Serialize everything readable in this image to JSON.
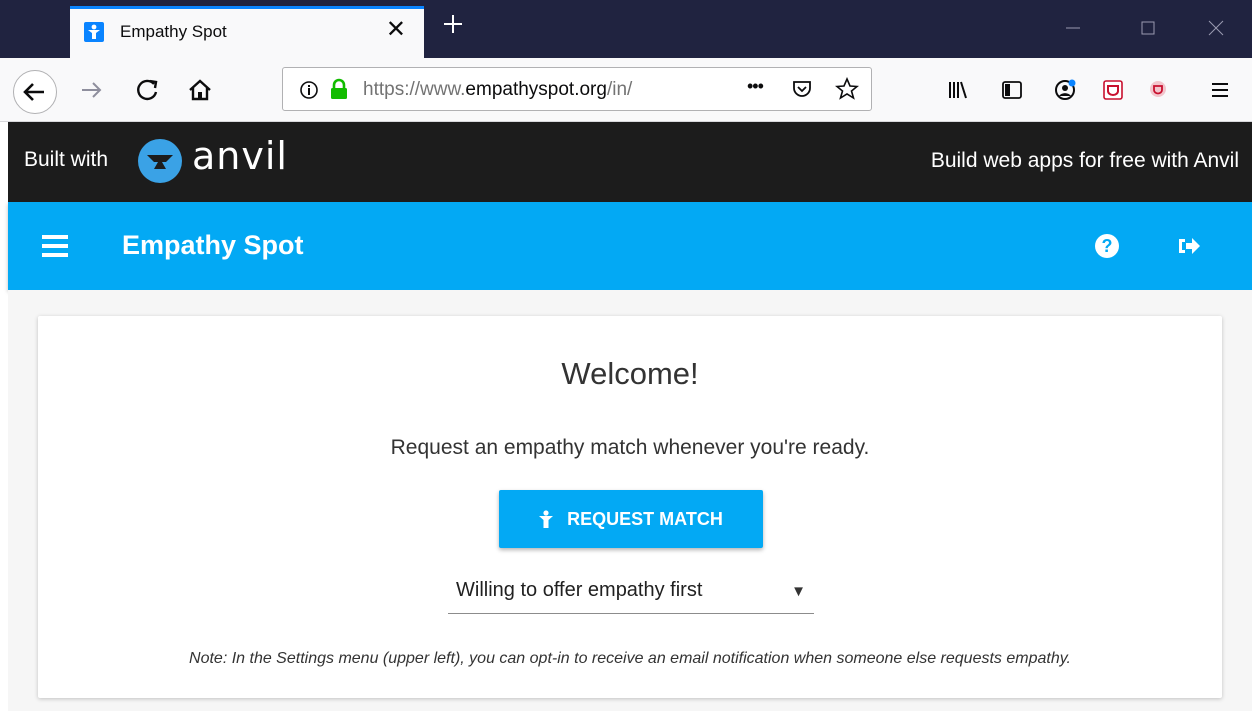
{
  "browser": {
    "tab": {
      "title": "Empathy Spot",
      "close_glyph": "✕"
    },
    "new_tab_glyph": "+",
    "url": {
      "prefix": "https://www.",
      "domain": "empathyspot.org",
      "path": "/in/"
    },
    "more_glyph": "•••"
  },
  "anvil_banner": {
    "built_with": "Built with",
    "brand": "anvil",
    "cta": "Build web apps for free with Anvil"
  },
  "header": {
    "title": "Empathy Spot",
    "help_glyph": "?"
  },
  "main": {
    "welcome": "Welcome!",
    "subtitle": "Request an empathy match whenever you're ready.",
    "request_button_label": "REQUEST MATCH",
    "dropdown": {
      "selected": "Willing to offer empathy first",
      "arrow": "▼"
    },
    "note": "Note: In the Settings menu (upper left), you can opt-in to receive an email notification when someone else requests empathy."
  },
  "colors": {
    "accent": "#03a9f4",
    "titlebar": "#202340",
    "anvil_banner": "#1c1c1c",
    "firefox_blue": "#0a84ff"
  }
}
